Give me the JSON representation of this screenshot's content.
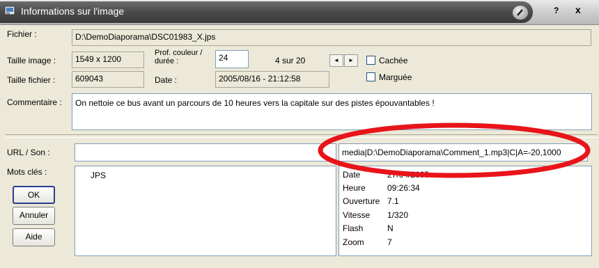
{
  "window": {
    "title": "Informations sur l'image",
    "help": "?",
    "close": "x"
  },
  "fields": {
    "fichier_label": "Fichier :",
    "fichier_value": "D:\\DemoDiaporama\\DSC01983_X.jps",
    "taille_image_label": "Taille image :",
    "taille_image_value": "1549 x 1200",
    "prof_label_line1": "Prof. couleur /",
    "prof_label_line2": "durée :",
    "prof_value": "24",
    "position_text": "4  sur 20",
    "taille_fichier_label": "Taille fichier :",
    "taille_fichier_value": "609043",
    "date_label": "Date :",
    "date_value": "2005/08/16 - 21:12:58",
    "cachee_label": "Cachée",
    "marquee_label": "Marguée",
    "commentaire_label": "Commentaire :",
    "commentaire_value": "On nettoie ce bus avant un parcours de 10 heures vers la capitale sur des pistes épouvantables !",
    "url_label": "URL / Son :",
    "url_value": "",
    "media_value": "media|D:\\DemoDiaporama\\Comment_1.mp3|C|A=-20,1000",
    "mots_label": "Mots clés :",
    "mots_value": "JPS"
  },
  "nav": {
    "prev": "◄",
    "next": "►"
  },
  "buttons": {
    "ok": "OK",
    "annuler": "Annuler",
    "aide": "Aide"
  },
  "exif": [
    {
      "key": "Date",
      "value": "27/04/2005"
    },
    {
      "key": "Heure",
      "value": "09:26:34"
    },
    {
      "key": "Ouverture",
      "value": "7.1"
    },
    {
      "key": "Vitesse",
      "value": "1/320"
    },
    {
      "key": "Flash",
      "value": "N"
    },
    {
      "key": "Zoom",
      "value": "7"
    }
  ],
  "colors": {
    "highlight_oval": "#e8141a",
    "titlebar": "#4a4a4a"
  }
}
